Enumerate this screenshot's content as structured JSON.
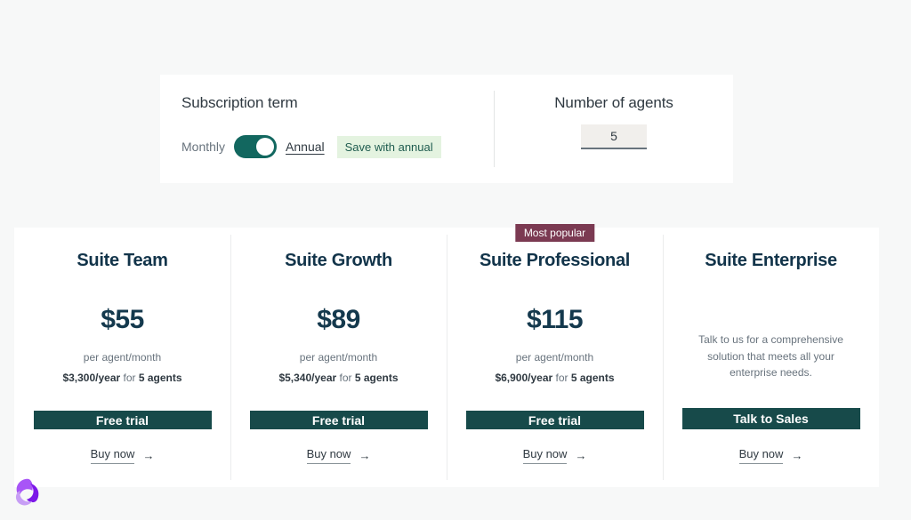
{
  "configurator": {
    "subscription_term": {
      "title": "Subscription term",
      "monthly_label": "Monthly",
      "annual_label": "Annual",
      "save_badge": "Save with annual",
      "selected": "Annual"
    },
    "agents": {
      "title": "Number of agents",
      "value": "5"
    }
  },
  "plans": [
    {
      "name": "Suite Team",
      "price": "$55",
      "per": "per agent/month",
      "year_amount": "$3,300/year",
      "year_mid": " for ",
      "year_agents": "5 agents",
      "cta": "Free trial",
      "buy_now": "Buy now",
      "arrow": "→"
    },
    {
      "name": "Suite Growth",
      "price": "$89",
      "per": "per agent/month",
      "year_amount": "$5,340/year",
      "year_mid": " for ",
      "year_agents": "5 agents",
      "cta": "Free trial",
      "buy_now": "Buy now",
      "arrow": "→"
    },
    {
      "name": "Suite Professional",
      "badge": "Most popular",
      "price": "$115",
      "per": "per agent/month",
      "year_amount": "$6,900/year",
      "year_mid": " for ",
      "year_agents": "5 agents",
      "cta": "Free trial",
      "buy_now": "Buy now",
      "arrow": "→"
    },
    {
      "name": "Suite Enterprise",
      "description": "Talk to us for a comprehensive solution that meets all your enterprise needs.",
      "cta": "Talk to Sales",
      "buy_now": "Buy now",
      "arrow": "→"
    }
  ],
  "colors": {
    "page_background": "#f7f8f8",
    "card_background": "#ffffff",
    "toggle_on": "#12675f",
    "cta_background": "#174a4a",
    "badge_popular": "#7b3a52",
    "save_badge_background": "#e4f3e0",
    "price_text": "#14394d"
  }
}
